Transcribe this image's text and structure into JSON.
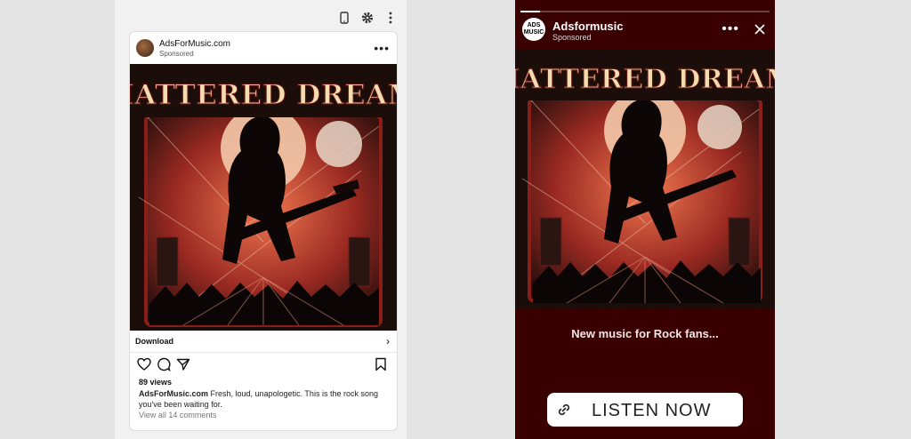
{
  "preview_toolbar": {
    "icons": [
      "mobile-icon",
      "gear-icon",
      "more-vertical-icon"
    ]
  },
  "feed_post": {
    "account_name": "AdsForMusic.com",
    "sponsored_label": "Sponsored",
    "more_label": "•••",
    "artwork_title": "SHATTERED DREAMS",
    "cta_label": "Download",
    "cta_chevron": "›",
    "views": "89 views",
    "caption_account": "AdsForMusic.com",
    "caption_text": "Fresh, loud, unapologetic. This is the rock song you've been waiting for.",
    "comments_link": "View all 14 comments"
  },
  "story": {
    "progress_fraction": 0.08,
    "avatar_text": "ADS MUSIC",
    "account_name": "Adsformusic",
    "sponsored_label": "Sponsored",
    "more_label": "•••",
    "artwork_title": "SHATTERED DREAMS",
    "tagline": "New music for Rock fans...",
    "cta_label": "LISTEN NOW"
  },
  "colors": {
    "story_background": "#3a0000",
    "artwork_title": "#f2dcb0",
    "artwork_frame": "#8a1f1a"
  }
}
